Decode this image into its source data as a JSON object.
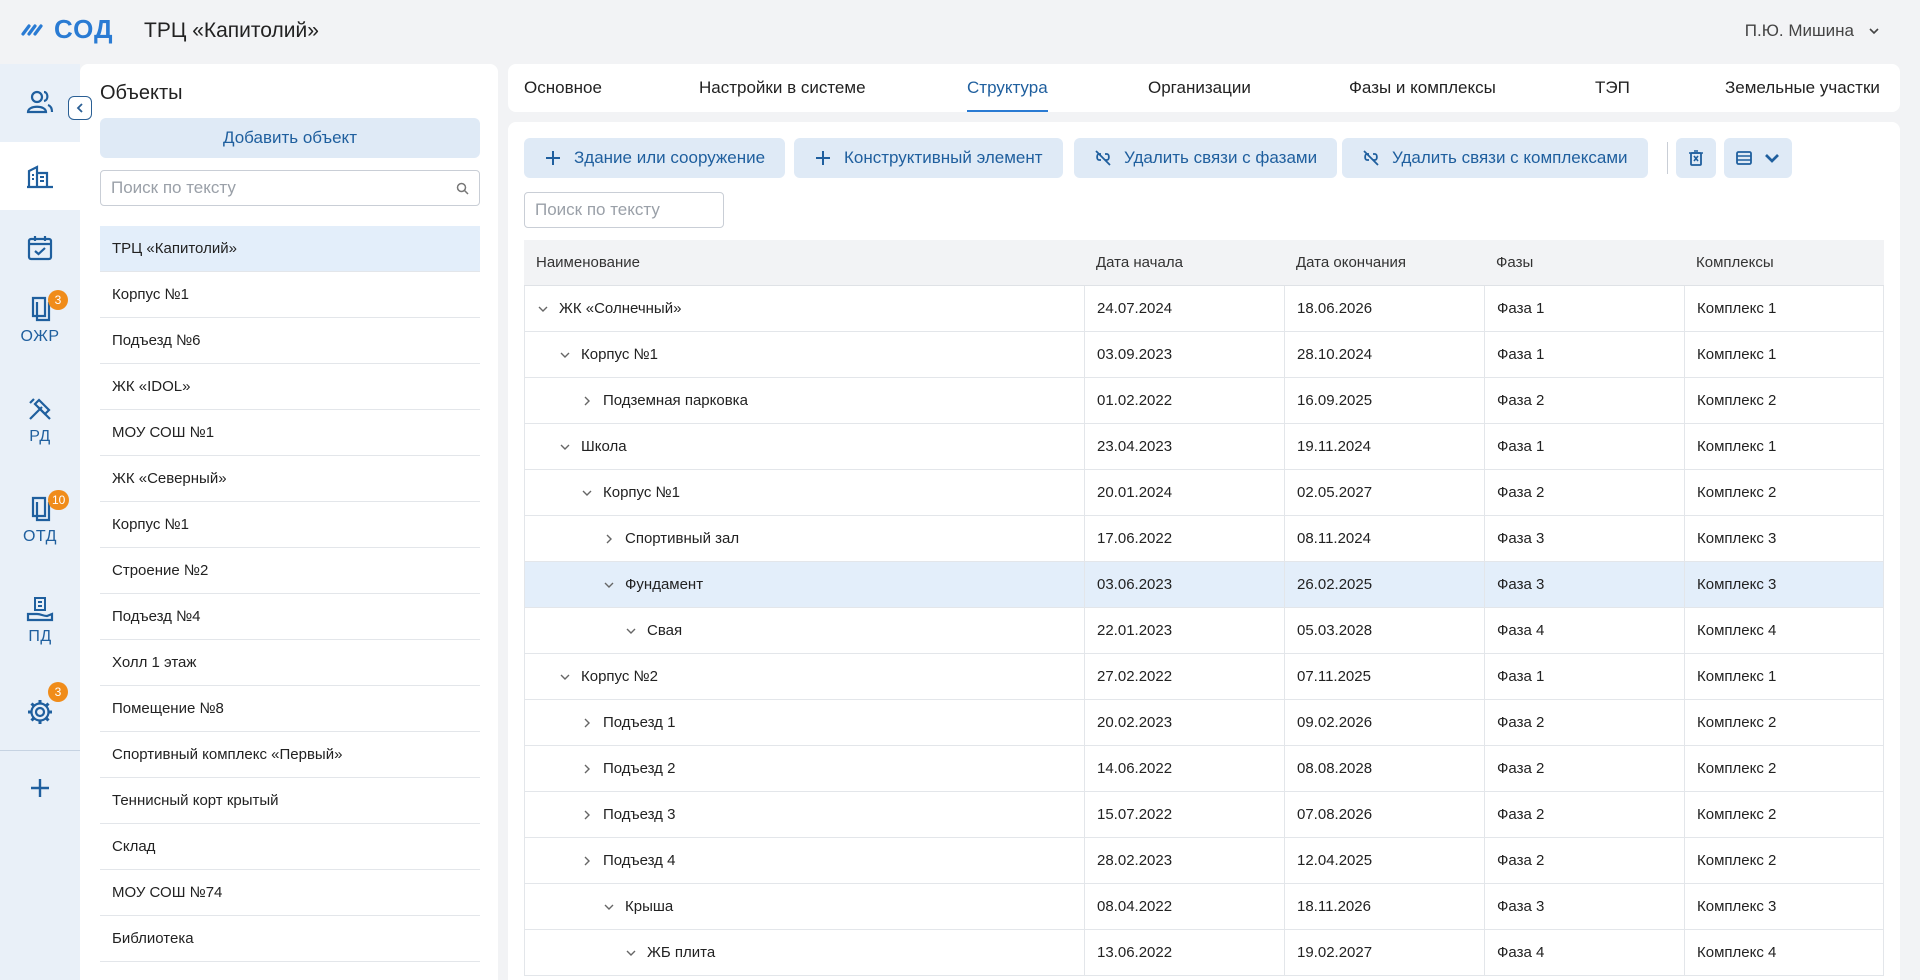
{
  "header": {
    "logo_text": "СОД",
    "title": "ТРЦ «Капитолий»",
    "user_name": "П.Ю. Мишина"
  },
  "rail": {
    "items": [
      {
        "name": "users",
        "label": "",
        "badge": ""
      },
      {
        "name": "objects",
        "label": "",
        "badge": ""
      },
      {
        "name": "tasks",
        "label": "",
        "badge": ""
      },
      {
        "name": "ozhr",
        "label": "ОЖР",
        "badge": "3"
      },
      {
        "name": "rd",
        "label": "РД",
        "badge": ""
      },
      {
        "name": "otd",
        "label": "ОТД",
        "badge": "10"
      },
      {
        "name": "pd",
        "label": "ПД",
        "badge": ""
      },
      {
        "name": "settings",
        "label": "",
        "badge": "3"
      },
      {
        "name": "add",
        "label": "",
        "badge": ""
      }
    ]
  },
  "objects_panel": {
    "title": "Объекты",
    "add_button": "Добавить объект",
    "search_placeholder": "Поиск по тексту",
    "items": [
      "ТРЦ «Капитолий»",
      "Корпус №1",
      "Подъезд №6",
      "ЖК «IDOL»",
      "МОУ СОШ №1",
      "ЖК «Северный»",
      "Корпус №1",
      "Строение №2",
      "Подъезд №4",
      "Холл 1 этаж",
      "Помещение №8",
      "Спортивный комплекс «Первый»",
      "Теннисный корт крытый",
      "Склад",
      "МОУ СОШ №74",
      "Библиотека"
    ],
    "selected_index": 0
  },
  "tabs": [
    {
      "label": "Основное"
    },
    {
      "label": "Настройки в системе"
    },
    {
      "label": "Структура"
    },
    {
      "label": "Организации"
    },
    {
      "label": "Фазы и комплексы"
    },
    {
      "label": "ТЭП"
    },
    {
      "label": "Земельные участки"
    }
  ],
  "active_tab": "Структура",
  "toolbar": {
    "add_building": "Здание или сооружение",
    "add_element": "Конструктивный элемент",
    "unlink_phases": "Удалить связи с фазами",
    "unlink_complexes": "Удалить связи с комплексами"
  },
  "table": {
    "search_placeholder": "Поиск по тексту",
    "columns": [
      "Наименование",
      "Дата начала",
      "Дата окончания",
      "Фазы",
      "Комплексы"
    ],
    "rows": [
      {
        "name": "ЖК «Солнечный»",
        "level": 0,
        "state": "open",
        "start": "24.07.2024",
        "end": "18.06.2026",
        "phase": "Фаза 1",
        "complex": "Комплекс 1"
      },
      {
        "name": "Корпус №1",
        "level": 1,
        "state": "open",
        "start": "03.09.2023",
        "end": "28.10.2024",
        "phase": "Фаза 1",
        "complex": "Комплекс 1"
      },
      {
        "name": "Подземная парковка",
        "level": 2,
        "state": "closed",
        "start": "01.02.2022",
        "end": "16.09.2025",
        "phase": "Фаза 2",
        "complex": "Комплекс 2"
      },
      {
        "name": "Школа",
        "level": 1,
        "state": "open",
        "start": "23.04.2023",
        "end": "19.11.2024",
        "phase": "Фаза 1",
        "complex": "Комплекс 1"
      },
      {
        "name": "Корпус №1",
        "level": 2,
        "state": "open",
        "start": "20.01.2024",
        "end": "02.05.2027",
        "phase": "Фаза 2",
        "complex": "Комплекс 2"
      },
      {
        "name": "Спортивный зал",
        "level": 3,
        "state": "closed",
        "start": "17.06.2022",
        "end": "08.11.2024",
        "phase": "Фаза 3",
        "complex": "Комплекс 3"
      },
      {
        "name": "Фундамент",
        "level": 3,
        "state": "open",
        "start": "03.06.2023",
        "end": "26.02.2025",
        "phase": "Фаза 3",
        "complex": "Комплекс 3",
        "selected": true
      },
      {
        "name": "Свая",
        "level": 4,
        "state": "open",
        "start": "22.01.2023",
        "end": "05.03.2028",
        "phase": "Фаза 4",
        "complex": "Комплекс 4"
      },
      {
        "name": "Корпус №2",
        "level": 1,
        "state": "open",
        "start": "27.02.2022",
        "end": "07.11.2025",
        "phase": "Фаза 1",
        "complex": "Комплекс 1"
      },
      {
        "name": "Подъезд 1",
        "level": 2,
        "state": "closed",
        "start": "20.02.2023",
        "end": "09.02.2026",
        "phase": "Фаза 2",
        "complex": "Комплекс 2"
      },
      {
        "name": "Подъезд 2",
        "level": 2,
        "state": "closed",
        "start": "14.06.2022",
        "end": "08.08.2028",
        "phase": "Фаза 2",
        "complex": "Комплекс 2"
      },
      {
        "name": "Подъезд 3",
        "level": 2,
        "state": "closed",
        "start": "15.07.2022",
        "end": "07.08.2026",
        "phase": "Фаза 2",
        "complex": "Комплекс 2"
      },
      {
        "name": "Подъезд 4",
        "level": 2,
        "state": "closed",
        "start": "28.02.2023",
        "end": "12.04.2025",
        "phase": "Фаза 2",
        "complex": "Комплекс 2"
      },
      {
        "name": "Крыша",
        "level": 3,
        "state": "open",
        "start": "08.04.2022",
        "end": "18.11.2026",
        "phase": "Фаза 3",
        "complex": "Комплекс 3"
      },
      {
        "name": "ЖБ плита",
        "level": 4,
        "state": "open",
        "start": "13.06.2022",
        "end": "19.02.2027",
        "phase": "Фаза 4",
        "complex": "Комплекс 4"
      }
    ]
  },
  "colors": {
    "accent": "#2a7bd3",
    "accent_dark": "#1f5f9e",
    "button_bg": "#dfeaf6",
    "badge": "#f08c1a",
    "selected_row": "#e3eefa"
  }
}
